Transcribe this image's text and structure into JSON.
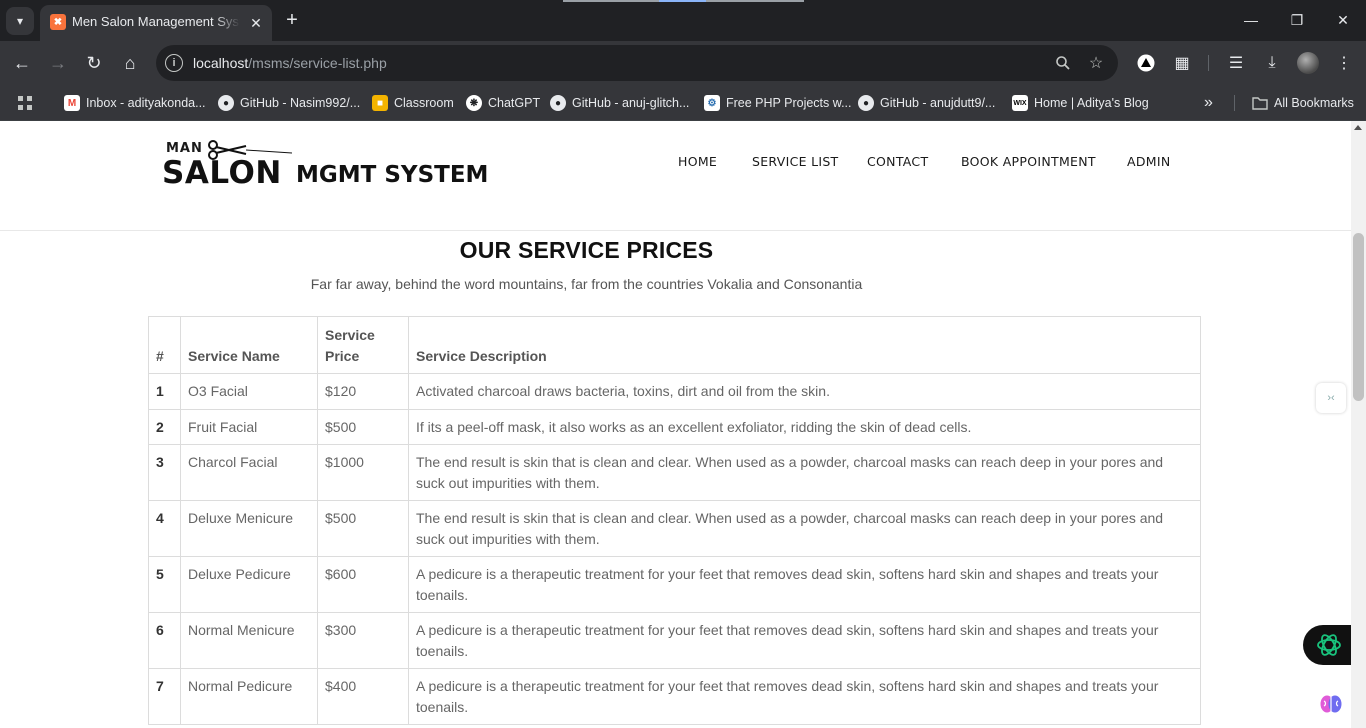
{
  "browser": {
    "tab_title": "Men Salon Management System",
    "url_host": "localhost",
    "url_path": "/msms/service-list.php",
    "bookmarks": [
      {
        "label": "Inbox - adityakonda...",
        "icon": "gmail-icon"
      },
      {
        "label": "GitHub - Nasim992/...",
        "icon": "github-icon"
      },
      {
        "label": "Classroom",
        "icon": "classroom-icon"
      },
      {
        "label": "ChatGPT",
        "icon": "chatgpt-icon"
      },
      {
        "label": "GitHub - anuj-glitch...",
        "icon": "github-icon"
      },
      {
        "label": "Free PHP Projects w...",
        "icon": "php-projects-icon"
      },
      {
        "label": "GitHub - anujdutt9/...",
        "icon": "github-icon"
      },
      {
        "label": "Home | Aditya's Blog",
        "icon": "wix-icon"
      }
    ],
    "all_bookmarks": "All Bookmarks"
  },
  "site": {
    "logo": {
      "man": "MAN",
      "salon": "SALON",
      "mgmt": "MGMT SYSTEM"
    },
    "nav": [
      "HOME",
      "SERVICE LIST",
      "CONTACT",
      "BOOK APPOINTMENT",
      "ADMIN"
    ],
    "section_title": "OUR SERVICE PRICES",
    "section_subtitle": "Far far away, behind the word mountains, far from the countries Vokalia and Consonantia",
    "table": {
      "headers": [
        "#",
        "Service Name",
        "Service Price",
        "Service Description"
      ],
      "rows": [
        {
          "num": "1",
          "name": "O3 Facial",
          "price": "$120",
          "desc": "Activated charcoal draws bacteria, toxins, dirt and oil from the skin."
        },
        {
          "num": "2",
          "name": "Fruit Facial",
          "price": "$500",
          "desc": "If its a peel-off mask, it also works as an excellent exfoliator, ridding the skin of dead cells."
        },
        {
          "num": "3",
          "name": "Charcol Facial",
          "price": "$1000",
          "desc": "The end result is skin that is clean and clear. When used as a powder, charcoal masks can reach deep in your pores and suck out impurities with them."
        },
        {
          "num": "4",
          "name": "Deluxe Menicure",
          "price": "$500",
          "desc": "The end result is skin that is clean and clear. When used as a powder, charcoal masks can reach deep in your pores and suck out impurities with them."
        },
        {
          "num": "5",
          "name": "Deluxe Pedicure",
          "price": "$600",
          "desc": "A pedicure is a therapeutic treatment for your feet that removes dead skin, softens hard skin and shapes and treats your toenails."
        },
        {
          "num": "6",
          "name": "Normal Menicure",
          "price": "$300",
          "desc": "A pedicure is a therapeutic treatment for your feet that removes dead skin, softens hard skin and shapes and treats your toenails."
        },
        {
          "num": "7",
          "name": "Normal Pedicure",
          "price": "$400",
          "desc": "A pedicure is a therapeutic treatment for your feet that removes dead skin, softens hard skin and shapes and treats your toenails."
        }
      ]
    }
  },
  "colors": {
    "chrome_dark": "#202124",
    "chrome_toolbar": "#35363a",
    "tab_favicon": "#f9733c"
  }
}
